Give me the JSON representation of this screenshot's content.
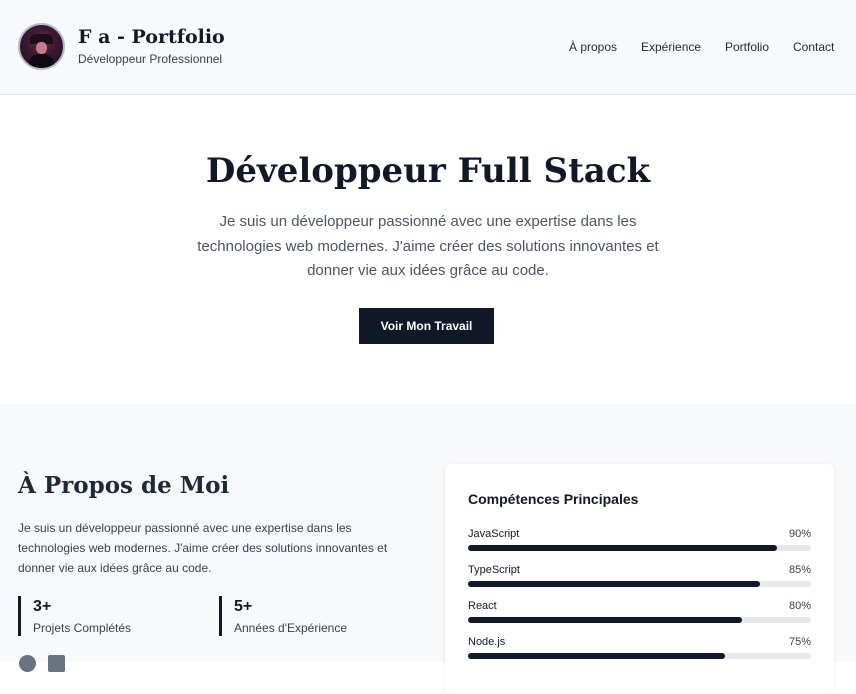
{
  "header": {
    "title": "F a - Portfolio",
    "subtitle": "Développeur Professionnel",
    "nav": [
      "À propos",
      "Expérience",
      "Portfolio",
      "Contact"
    ]
  },
  "hero": {
    "title": "Développeur Full Stack",
    "text": "Je suis un développeur passionné avec une expertise dans les technologies web modernes. J'aime créer des solutions innovantes et donner vie aux idées grâce au code.",
    "cta": "Voir Mon Travail"
  },
  "about": {
    "title": "À Propos de Moi",
    "text": "Je suis un développeur passionné avec une expertise dans les technologies web modernes. J'aime créer des solutions innovantes et donner vie aux idées grâce au code.",
    "stats": [
      {
        "value": "3+",
        "label": "Projets Complétés"
      },
      {
        "value": "5+",
        "label": "Années d'Expérience"
      }
    ],
    "social_icons": [
      "github-icon",
      "linkedin-icon"
    ]
  },
  "skills": {
    "title": "Compétences Principales",
    "items": [
      {
        "name": "JavaScript",
        "percent_label": "90%",
        "level": 0.9
      },
      {
        "name": "TypeScript",
        "percent_label": "85%",
        "level": 0.85
      },
      {
        "name": "React",
        "percent_label": "80%",
        "level": 0.8
      },
      {
        "name": "Node.js",
        "percent_label": "75%",
        "level": 0.75
      }
    ]
  },
  "colors": {
    "primary": "#111827",
    "background_alt": "#f8f9fb",
    "track": "#e5e7eb",
    "text_muted": "#4b5563"
  }
}
